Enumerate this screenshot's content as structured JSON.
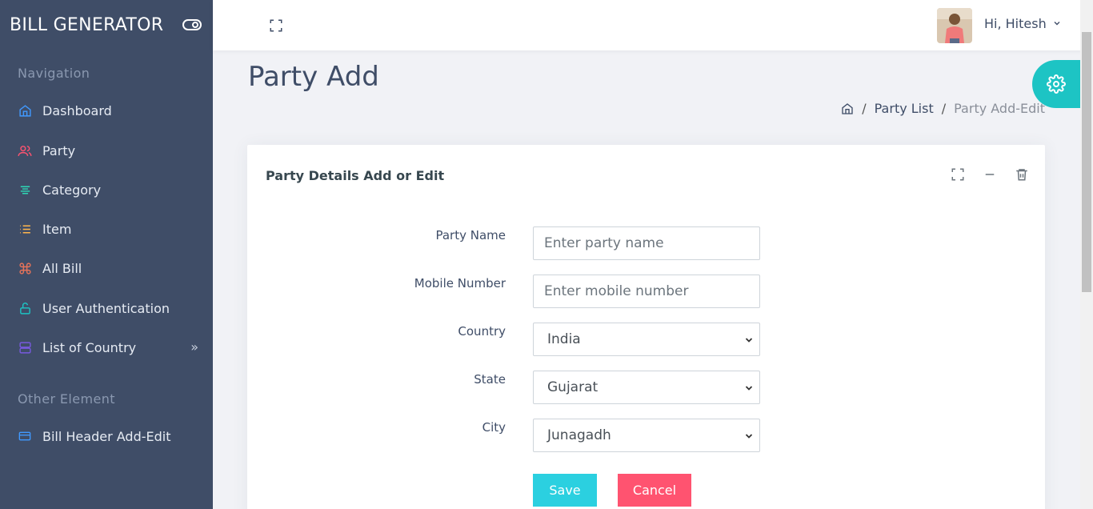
{
  "brand": {
    "name": "BILL GENERATOR"
  },
  "sidebar": {
    "caption_navigation": "Navigation",
    "caption_other": "Other Element",
    "items": [
      {
        "label": "Dashboard",
        "icon": "home-icon",
        "color": "#4099ff"
      },
      {
        "label": "Party",
        "icon": "users-icon",
        "color": "#ff5370"
      },
      {
        "label": "Category",
        "icon": "align-center-icon",
        "color": "#2ed8b6"
      },
      {
        "label": "Item",
        "icon": "list-icon",
        "color": "#ffb64d"
      },
      {
        "label": "All Bill",
        "icon": "command-icon",
        "color": "#e6735a"
      },
      {
        "label": "User Authentication",
        "icon": "unlock-icon",
        "color": "#1dc4c4"
      },
      {
        "label": "List of Country",
        "icon": "server-icon",
        "color": "#7759de"
      },
      {
        "label": "Bill Header Add-Edit",
        "icon": "credit-card-icon",
        "color": "#4099ff"
      }
    ]
  },
  "header": {
    "greeting": "Hi, Hitesh"
  },
  "page": {
    "title": "Party Add",
    "breadcrumb": [
      "Party List",
      "Party Add-Edit"
    ]
  },
  "card": {
    "title": "Party Details Add or Edit",
    "fields": {
      "party_name_label": "Party Name",
      "party_name_placeholder": "Enter party name",
      "mobile_label": "Mobile Number",
      "mobile_placeholder": "Enter mobile number",
      "country_label": "Country",
      "country_value": "India",
      "state_label": "State",
      "state_value": "Gujarat",
      "city_label": "City",
      "city_value": "Junagadh"
    },
    "save_label": "Save",
    "cancel_label": "Cancel"
  },
  "colors": {
    "sidebar_bg": "#3f4d67",
    "accent_teal": "#1dc4c4",
    "save_btn": "#2bd0e0",
    "cancel_btn": "#ff5370"
  }
}
